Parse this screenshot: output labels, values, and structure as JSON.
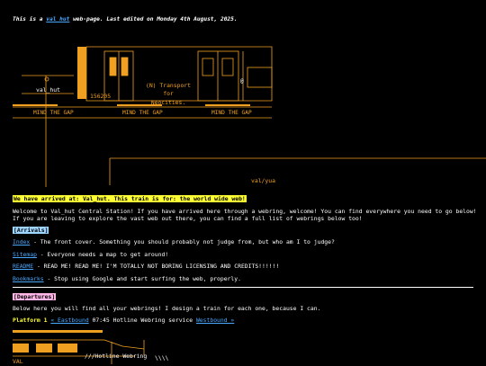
{
  "intro": {
    "before": "This is a ",
    "link": "val_hut",
    "after": " web-page. Last edited on Monday 4th August, 2025."
  },
  "scene": {
    "sign_label": "val_hut",
    "train_number": "156205",
    "train_destination_line1": "(N) Transport for",
    "train_destination_line2": "Neocities.",
    "mind_gap": [
      "MIND THE GAP",
      "MIND THE GAP",
      "MIND THE GAP"
    ],
    "sign_bottom_right": "val/yua"
  },
  "arrival_banner": "We have arrived at: Val_hut. This train is for: the world wide web!",
  "welcome": {
    "line1": "Welcome to Val_hut Central Station! If you have arrived here through a webring, welcome! You can find everywhere you need to go below!",
    "line2": "If you are leaving to explore the vast web out there, you can find a full list of webrings below too!"
  },
  "arrivals": {
    "heading": "[Arrivals]",
    "items": [
      {
        "link": "Index",
        "text": " - The front cover. Something you should probably not judge from, but who am I to judge?"
      },
      {
        "link": "Sitemap",
        "text": " - Everyone needs a map to get around!"
      },
      {
        "link": "README",
        "text": " - READ ME! READ ME! I'M TOTALLY NOT BORING LICENSING AND CREDITS!!!!!!"
      },
      {
        "link": "Bookmarks",
        "text": " - Stop using Google and start surfing the web, properly."
      }
    ]
  },
  "departures": {
    "heading": "[Departures]",
    "intro": "Below here you will find all your webrings! I design a train for each one, because I can.",
    "platform_label": "Platform 1",
    "eastbound": "« Eastbound",
    "service": " 07:45 Hotline Webring service ",
    "westbound": "Westbound »",
    "train_label": "///Hotline Webring",
    "train_tail": "\\\\\\\\",
    "val_label": "VAL"
  },
  "colors": {
    "background": "#000000",
    "accent": "#f0a020",
    "link": "#4aa8ff",
    "highlight_yellow": "#ffff33",
    "highlight_blue": "#9fd6ff",
    "highlight_pink": "#ffb6e6"
  }
}
